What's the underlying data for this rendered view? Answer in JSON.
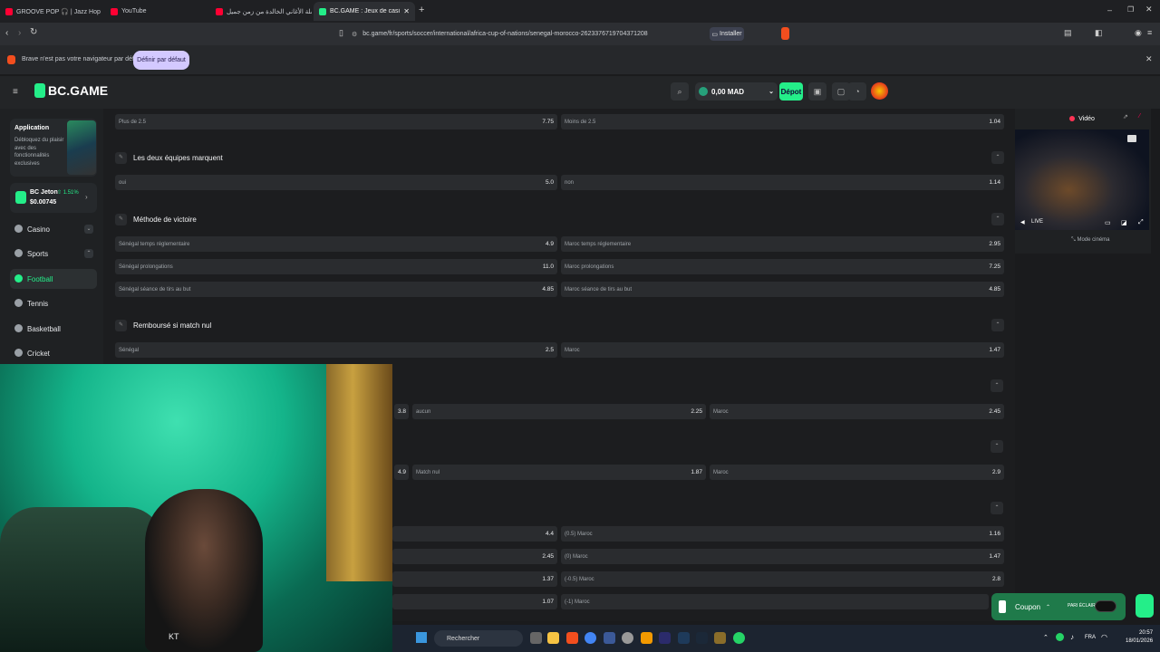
{
  "browser": {
    "tabs": [
      {
        "label": "GROOVE POP 🎧 | Jazz Hop ...",
        "color": "#ff0033"
      },
      {
        "label": "YouTube",
        "color": "#ff0033"
      },
      {
        "label": "جيل حفلة الأغاني الخالدة من زمن جميل",
        "color": "#ff0033"
      },
      {
        "label": "BC.GAME : Jeux de casino crypto",
        "color": "#24ee89"
      }
    ],
    "url": "bc.game/fr/sports/soccer/international/africa-cup-of-nations/senegal-morocco-2623376719704371208",
    "install_label": "Installer",
    "info_text": "Brave n'est pas votre navigateur par défaut",
    "set_default_label": "Définir par défaut"
  },
  "site": {
    "logo": "BC.GAME",
    "wallet_amount": "0,00 MAD",
    "deposit_label": "Dépot"
  },
  "sidebar": {
    "app_title": "Application",
    "app_desc": "Débloquez du plaisir avec des fonctionnalités exclusives",
    "jeton_name": "BC Jeton",
    "jeton_change": "1.51%",
    "jeton_value": "$0.00745",
    "items": [
      {
        "label": "Casino"
      },
      {
        "label": "Sports"
      },
      {
        "label": "Football"
      },
      {
        "label": "Tennis"
      },
      {
        "label": "Basketball"
      },
      {
        "label": "Cricket"
      }
    ]
  },
  "markets": {
    "total_row": {
      "left_label": "Plus de 2.5",
      "left_odd": "7.75",
      "right_label": "Moins de 2.5",
      "right_odd": "1.04"
    },
    "btts": {
      "title": "Les deux équipes marquent",
      "left_label": "oui",
      "left_odd": "5.0",
      "right_label": "non",
      "right_odd": "1.14"
    },
    "method": {
      "title": "Méthode de victoire",
      "rows": [
        {
          "left_label": "Sénégal temps réglementaire",
          "left_odd": "4.9",
          "right_label": "Maroc temps réglementaire",
          "right_odd": "2.95"
        },
        {
          "left_label": "Sénégal prolongations",
          "left_odd": "11.0",
          "right_label": "Maroc prolongations",
          "right_odd": "7.25"
        },
        {
          "left_label": "Sénégal séance de tirs au but",
          "left_odd": "4.85",
          "right_label": "Maroc séance de tirs au but",
          "right_odd": "4.85"
        }
      ]
    },
    "dnb": {
      "title": "Remboursé si match nul",
      "left_label": "Sénégal",
      "left_odd": "2.5",
      "right_label": "Maroc",
      "right_odd": "1.47"
    },
    "partial1": {
      "left_odd": "3.8",
      "mid_label": "aucun",
      "mid_odd": "2.25",
      "right_label": "Maroc",
      "right_odd": "2.45"
    },
    "partial2": {
      "left_odd": "4.9",
      "mid_label": "Match nul",
      "mid_odd": "1.87",
      "right_label": "Maroc",
      "right_odd": "2.9"
    },
    "handicap": [
      {
        "left_odd": "4.4",
        "right_label": "(0.5) Maroc",
        "right_odd": "1.16"
      },
      {
        "left_odd": "2.45",
        "right_label": "(0) Maroc",
        "right_odd": "1.47"
      },
      {
        "left_odd": "1.37",
        "right_label": "(-0.5) Maroc",
        "right_odd": "2.8"
      },
      {
        "left_odd": "1.07",
        "right_label": "(-1) Maroc",
        "right_odd": ""
      }
    ]
  },
  "video": {
    "title": "Vidéo",
    "live_label": "LIVE",
    "cinema_label": "Mode cinéma"
  },
  "coupon": {
    "label": "Coupon",
    "mode": "PARI ÉCLAIR"
  },
  "taskbar": {
    "search_label": "Rechercher",
    "lang": "FRA",
    "time": "20:57",
    "date": "18/01/2026"
  },
  "webcam": {
    "text": "KT"
  }
}
